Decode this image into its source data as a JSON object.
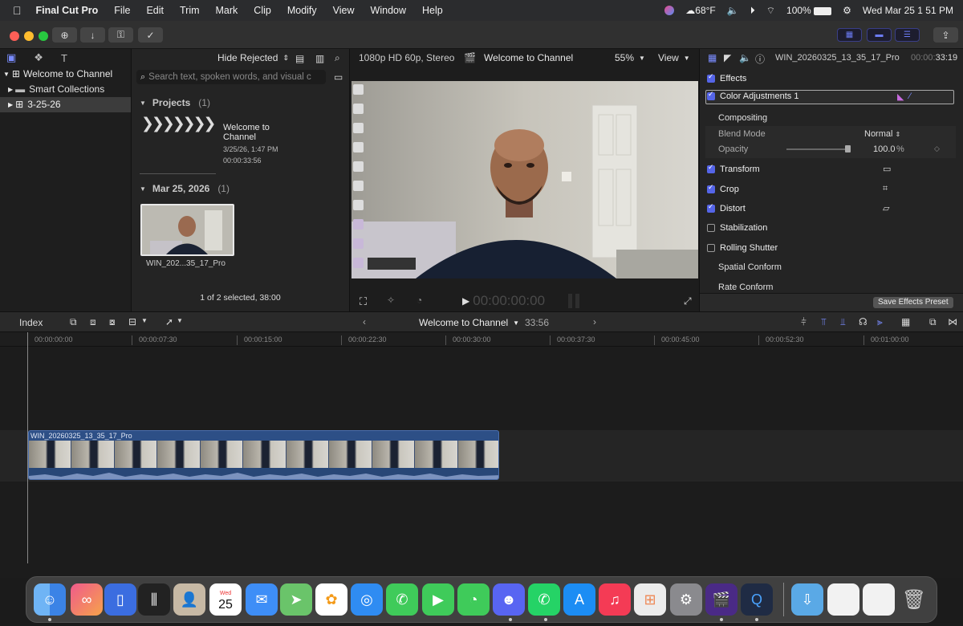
{
  "menubar": {
    "apple": "",
    "app": "Final Cut Pro",
    "items": [
      "File",
      "Edit",
      "Trim",
      "Mark",
      "Clip",
      "Modify",
      "View",
      "Window",
      "Help"
    ],
    "weather": "68°F",
    "battery": "100%",
    "clock": "Wed Mar 25  1 51 PM"
  },
  "library": {
    "name": "Welcome to Channel",
    "smart_collections": "Smart Collections",
    "event": "3-25-26"
  },
  "browser": {
    "filter": "Hide Rejected",
    "search_placeholder": "Search text, spoken words, and visual c",
    "projects_header": "Projects",
    "projects_count": "(1)",
    "project_title": "Welcome to Channel",
    "project_date": "3/25/26, 1:47 PM",
    "project_duration": "00:00:33:56",
    "date_header": "Mar 25, 2026",
    "date_count": "(1)",
    "clip_name": "WIN_202...35_17_Pro",
    "status": "1 of 2 selected, 38:00"
  },
  "viewer": {
    "format": "1080p HD 60p, Stereo",
    "project": "Welcome to Channel",
    "zoom": "55%",
    "view_label": "View",
    "timecode": "00:00:00:00"
  },
  "inspector": {
    "clip_name": "WIN_20260325_13_35_17_Pro",
    "time_dim": "00:00:",
    "time": "33:19",
    "effects": "Effects",
    "color_adj": "Color Adjustments 1",
    "compositing": "Compositing",
    "blend_mode_label": "Blend Mode",
    "blend_mode_value": "Normal",
    "opacity_label": "Opacity",
    "opacity_value": "100.0",
    "opacity_unit": "%",
    "opacity_level": 1.0,
    "transform": "Transform",
    "crop": "Crop",
    "distort": "Distort",
    "stabilization": "Stabilization",
    "rolling_shutter": "Rolling Shutter",
    "spatial_conform": "Spatial Conform",
    "rate_conform": "Rate Conform",
    "save_preset": "Save Effects Preset"
  },
  "timeline": {
    "index": "Index",
    "project": "Welcome to Channel",
    "duration": "33:56",
    "ruler": [
      "00:00:00:00",
      "00:00:07:30",
      "00:00:15:00",
      "00:00:22:30",
      "00:00:30:00",
      "00:00:37:30",
      "00:00:45:00",
      "00:00:52:30",
      "00:01:00:00"
    ],
    "clip_name": "WIN_20260325_13_35_17_Pro"
  },
  "dock": {
    "calendar_month": "Wed",
    "calendar_day": "25",
    "apps": [
      "finder-icon",
      "app-icon",
      "simulator-icon",
      "keychain-icon",
      "contacts-icon",
      "calendar-icon",
      "mail-icon",
      "maps-icon",
      "photos-icon",
      "safari-icon",
      "phone-icon",
      "facetime-icon",
      "messages-icon",
      "discord-icon",
      "whatsapp-icon",
      "app-store-icon",
      "music-icon",
      "launchpad-icon",
      "system-settings-icon",
      "final-cut-pro-icon",
      "quicktime-icon"
    ]
  },
  "colors": {
    "accent": "#5565e8",
    "clip": "#2d4f86"
  }
}
